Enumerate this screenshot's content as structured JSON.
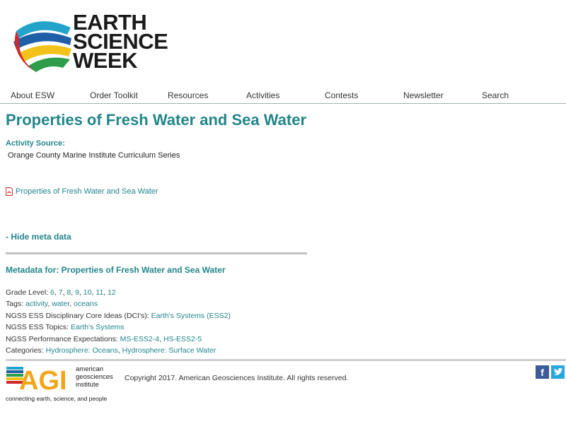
{
  "header": {
    "logo_lines": [
      "EARTH",
      "SCIENCE",
      "WEEK"
    ]
  },
  "nav": {
    "items": [
      "About ESW",
      "Order Toolkit",
      "Resources",
      "Activities",
      "Contests",
      "Newsletter",
      "Search"
    ]
  },
  "page": {
    "title": "Properties of Fresh Water and Sea Water",
    "activity_source_label": "Activity Source:",
    "activity_source_value": "Orange County Marine Institute Curriculum Series",
    "pdf_link": "Properties of Fresh Water and Sea Water",
    "hide_meta_label": "- Hide meta data",
    "metadata_heading": "Metadata for: Properties of Fresh Water and Sea Water"
  },
  "metadata": {
    "grade_label": "Grade Level:",
    "grades": [
      "6",
      "7",
      "8",
      "9",
      "10",
      "11",
      "12"
    ],
    "tags_label": "Tags:",
    "tags": [
      "activity",
      "water",
      "oceans"
    ],
    "dci_label": "NGSS ESS Disciplinary Core Ideas (DCI's):",
    "dci": [
      "Earth's Systems (ESS2)"
    ],
    "topics_label": "NGSS ESS Topics:",
    "topics": [
      "Earth's Systems"
    ],
    "pe_label": "NGSS Performance Expectations:",
    "pe": [
      "MS-ESS2-4",
      "HS-ESS2-5"
    ],
    "categories_label": "Categories:",
    "categories": [
      "Hydrosphere: Oceans",
      "Hydrosphere: Surface Water"
    ]
  },
  "footer": {
    "agi_letters": "AGI",
    "agi_words": [
      "american",
      "geosciences",
      "institute"
    ],
    "agi_tagline": "connecting earth, science, and people",
    "copyright": "Copyright 2017. American Geosciences Institute. All rights reserved.",
    "facebook_glyph": "f"
  },
  "colors": {
    "accent": "#23858a",
    "facebook": "#3b5a98",
    "twitter": "#29a8e0"
  }
}
